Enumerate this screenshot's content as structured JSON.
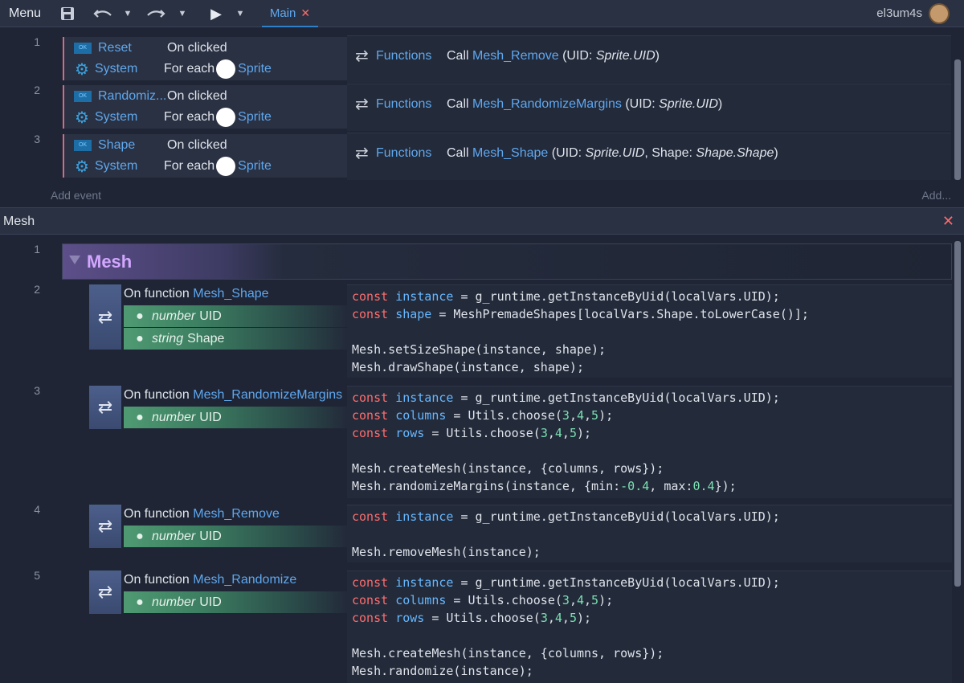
{
  "topbar": {
    "menu_label": "Menu",
    "tab_main_label": "Main",
    "user_name": "el3um4s",
    "icons": [
      "save-icon",
      "undo-icon",
      "redo-icon",
      "play-icon",
      "close-icon"
    ]
  },
  "events_main": [
    {
      "number": "1",
      "conditions": [
        {
          "object": "Reset",
          "text": "On clicked"
        },
        {
          "object": "System",
          "text": "For each",
          "target": "Sprite"
        }
      ],
      "action": {
        "label": "Functions",
        "call": "Call",
        "function": "Mesh_Remove",
        "args": "(UID: ",
        "arg_italic": "Sprite.UID",
        "args_end": ")"
      }
    },
    {
      "number": "2",
      "conditions": [
        {
          "object": "Randomiz...",
          "text": "On clicked"
        },
        {
          "object": "System",
          "text": "For each",
          "target": "Sprite"
        }
      ],
      "action": {
        "label": "Functions",
        "call": "Call",
        "function": "Mesh_RandomizeMargins",
        "args": "(UID: ",
        "arg_italic": "Sprite.UID",
        "args_end": ")"
      }
    },
    {
      "number": "3",
      "conditions": [
        {
          "object": "Shape",
          "text": "On clicked"
        },
        {
          "object": "System",
          "text": "For each",
          "target": "Sprite"
        }
      ],
      "action": {
        "label": "Functions",
        "call": "Call",
        "function": "Mesh_Shape",
        "args": "(UID: ",
        "arg_italic": "Sprite.UID",
        "args_mid": ", Shape: ",
        "arg_italic2": "Shape.Shape",
        "args_end": ")"
      }
    }
  ],
  "add_event_label": "Add event",
  "add_action_label": "Add...",
  "mesh_sheet": {
    "title": "Mesh",
    "group_number": "1",
    "group_title": "Mesh",
    "functions": [
      {
        "number": "2",
        "on_function": "On function",
        "name": "Mesh_Shape",
        "params": [
          {
            "type": "number",
            "name": "UID"
          },
          {
            "type": "string",
            "name": "Shape"
          }
        ],
        "code": [
          [
            [
              "kw",
              "const"
            ],
            [
              "t",
              " "
            ],
            [
              "var",
              "instance"
            ],
            [
              "t",
              " = g_runtime.getInstanceByUid(localVars.UID);"
            ]
          ],
          [
            [
              "kw",
              "const"
            ],
            [
              "t",
              " "
            ],
            [
              "var",
              "shape"
            ],
            [
              "t",
              " = MeshPremadeShapes[localVars.Shape.toLowerCase()];"
            ]
          ],
          [
            [
              "t",
              ""
            ]
          ],
          [
            [
              "t",
              "Mesh.setSizeShape(instance, shape);"
            ]
          ],
          [
            [
              "t",
              "Mesh.drawShape(instance, shape);"
            ]
          ]
        ]
      },
      {
        "number": "3",
        "on_function": "On function",
        "name": "Mesh_RandomizeMargins",
        "params": [
          {
            "type": "number",
            "name": "UID"
          }
        ],
        "code": [
          [
            [
              "kw",
              "const"
            ],
            [
              "t",
              " "
            ],
            [
              "var",
              "instance"
            ],
            [
              "t",
              " = g_runtime.getInstanceByUid(localVars.UID);"
            ]
          ],
          [
            [
              "kw",
              "const"
            ],
            [
              "t",
              " "
            ],
            [
              "var",
              "columns"
            ],
            [
              "t",
              " = Utils.choose("
            ],
            [
              "num",
              "3"
            ],
            [
              "t",
              ","
            ],
            [
              "num",
              "4"
            ],
            [
              "t",
              ","
            ],
            [
              "num",
              "5"
            ],
            [
              "t",
              ");"
            ]
          ],
          [
            [
              "kw",
              "const"
            ],
            [
              "t",
              " "
            ],
            [
              "var",
              "rows"
            ],
            [
              "t",
              " = Utils.choose("
            ],
            [
              "num",
              "3"
            ],
            [
              "t",
              ","
            ],
            [
              "num",
              "4"
            ],
            [
              "t",
              ","
            ],
            [
              "num",
              "5"
            ],
            [
              "t",
              ");"
            ]
          ],
          [
            [
              "t",
              ""
            ]
          ],
          [
            [
              "t",
              "Mesh.createMesh(instance, {columns, rows});"
            ]
          ],
          [
            [
              "t",
              "Mesh.randomizeMargins(instance, {min:"
            ],
            [
              "num",
              "-0.4"
            ],
            [
              "t",
              ", max:"
            ],
            [
              "num",
              "0.4"
            ],
            [
              "t",
              "});"
            ]
          ]
        ]
      },
      {
        "number": "4",
        "on_function": "On function",
        "name": "Mesh_Remove",
        "params": [
          {
            "type": "number",
            "name": "UID"
          }
        ],
        "code": [
          [
            [
              "kw",
              "const"
            ],
            [
              "t",
              " "
            ],
            [
              "var",
              "instance"
            ],
            [
              "t",
              " = g_runtime.getInstanceByUid(localVars.UID);"
            ]
          ],
          [
            [
              "t",
              ""
            ]
          ],
          [
            [
              "t",
              "Mesh.removeMesh(instance);"
            ]
          ]
        ]
      },
      {
        "number": "5",
        "on_function": "On function",
        "name": "Mesh_Randomize",
        "params": [
          {
            "type": "number",
            "name": "UID"
          }
        ],
        "code": [
          [
            [
              "kw",
              "const"
            ],
            [
              "t",
              " "
            ],
            [
              "var",
              "instance"
            ],
            [
              "t",
              " = g_runtime.getInstanceByUid(localVars.UID);"
            ]
          ],
          [
            [
              "kw",
              "const"
            ],
            [
              "t",
              " "
            ],
            [
              "var",
              "columns"
            ],
            [
              "t",
              " = Utils.choose("
            ],
            [
              "num",
              "3"
            ],
            [
              "t",
              ","
            ],
            [
              "num",
              "4"
            ],
            [
              "t",
              ","
            ],
            [
              "num",
              "5"
            ],
            [
              "t",
              ");"
            ]
          ],
          [
            [
              "kw",
              "const"
            ],
            [
              "t",
              " "
            ],
            [
              "var",
              "rows"
            ],
            [
              "t",
              " = Utils.choose("
            ],
            [
              "num",
              "3"
            ],
            [
              "t",
              ","
            ],
            [
              "num",
              "4"
            ],
            [
              "t",
              ","
            ],
            [
              "num",
              "5"
            ],
            [
              "t",
              ");"
            ]
          ],
          [
            [
              "t",
              ""
            ]
          ],
          [
            [
              "t",
              "Mesh.createMesh(instance, {columns, rows});"
            ]
          ],
          [
            [
              "t",
              "Mesh.randomize(instance);"
            ]
          ]
        ]
      }
    ]
  },
  "colors": {
    "accent": "#2f80c8",
    "condition_border": "#d46a84",
    "group_title": "#d3a7ff",
    "keyword": "#ff6d6d",
    "variable": "#67b8ff",
    "number": "#7be0b2"
  }
}
